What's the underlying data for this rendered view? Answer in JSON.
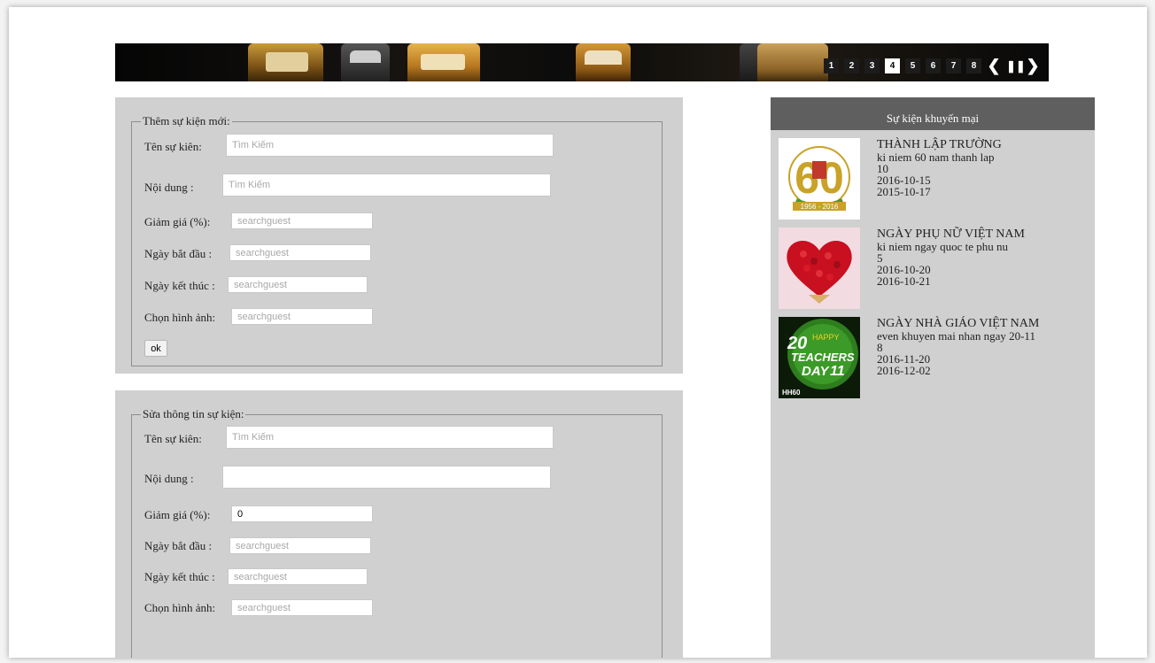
{
  "banner": {
    "pages": [
      "1",
      "2",
      "3",
      "4",
      "5",
      "6",
      "7",
      "8"
    ],
    "active_page": "4",
    "prev_label": "❮",
    "pause_label": "❚❚",
    "next_label": "❯"
  },
  "add_form": {
    "legend": "Thêm sự kiện mới:",
    "name_label": "Tên sự kiên:",
    "name_placeholder": "Tìm Kiếm",
    "content_label": "Nội dung :",
    "content_placeholder": "Tìm Kiếm",
    "discount_label": "Giảm giá (%):",
    "discount_placeholder": "searchguest",
    "start_label": "Ngày bắt đầu :",
    "start_placeholder": "searchguest",
    "end_label": "Ngày kết thúc :",
    "end_placeholder": "searchguest",
    "image_label": "Chọn hình ảnh:",
    "image_placeholder": "searchguest",
    "ok_label": "ok"
  },
  "edit_form": {
    "legend": "Sửa thông tin sự kiện:",
    "name_label": "Tên sự kiên:",
    "name_placeholder": "Tìm Kiếm",
    "content_label": "Nội dung :",
    "content_value": "",
    "discount_label": "Giảm giá (%):",
    "discount_value": "0",
    "start_label": "Ngày bắt đầu :",
    "start_placeholder": "searchguest",
    "end_label": "Ngày kết thúc :",
    "end_placeholder": "searchguest",
    "image_label": "Chọn hình ảnh:",
    "image_placeholder": "searchguest"
  },
  "sidebar": {
    "title": "Sự kiện khuyến mại",
    "events": [
      {
        "title": "THÀNH LẬP TRƯỜNG",
        "description": "ki niem 60 nam thanh lap",
        "discount": "10",
        "start": "2016-10-15",
        "end": "2015-10-17",
        "thumb": {
          "big_text": "60",
          "small_text": "1956 - 2016",
          "accent": "#c9a227"
        }
      },
      {
        "title": "NGÀY PHỤ NỮ VIỆT NAM",
        "description": "ki niem ngay quoc te phu nu",
        "discount": "5",
        "start": "2016-10-20",
        "end": "2016-10-21",
        "thumb": {
          "accent": "#c81020"
        }
      },
      {
        "title": "NGÀY NHÀ GIÁO VIỆT NAM",
        "description": "even khuyen mai nhan ngay 20-11",
        "discount": "8",
        "start": "2016-11-20",
        "end": "2016-12-02",
        "thumb": {
          "line1": "20",
          "line2": "HAPPY",
          "line3": "TEACHERS",
          "line4": "DAY",
          "line5": "11",
          "corner": "HH60",
          "accent": "#2e7d1e"
        }
      }
    ]
  }
}
